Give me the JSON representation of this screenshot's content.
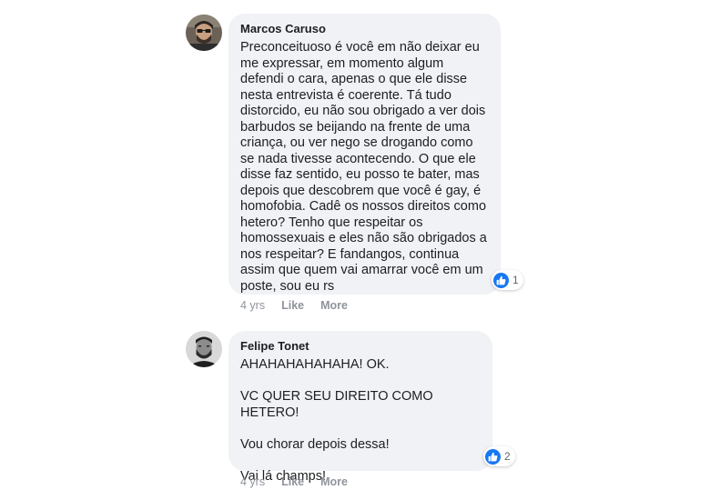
{
  "comments": [
    {
      "author": "Marcos Caruso",
      "text": "Preconceituoso é você em não deixar eu me expressar, em momento algum defendi o cara, apenas o que ele disse nesta entrevista é coerente. Tá tudo distorcido, eu não sou obrigado a ver dois barbudos se beijando na frente de uma criança, ou ver nego se drogando como se nada tivesse acontecendo. O que ele disse faz sentido, eu posso te bater, mas depois que descobrem que você é gay, é homofobia. Cadê os nossos direitos como hetero? Tenho que respeitar os homossexuais e eles não são obrigados a nos respeitar? E fandangos, continua assim que quem vai amarrar você em um poste, sou eu rs",
      "reaction_icon": "like-icon",
      "reaction_count": "1",
      "time": "4 yrs",
      "like_label": "Like",
      "more_label": "More"
    },
    {
      "author": "Felipe Tonet",
      "text": "AHAHAHAHAHAHA! OK.\n\nVC QUER SEU DIREITO COMO HETERO!\n\nVou chorar depois dessa!\n\nVai lá champs!",
      "reaction_icon": "like-icon",
      "reaction_count": "2",
      "time": "4 yrs",
      "like_label": "Like",
      "more_label": "More"
    }
  ],
  "colors": {
    "bubble": "#f0f2f5",
    "like_badge": "#1877f2",
    "meta_text": "#90949c"
  }
}
